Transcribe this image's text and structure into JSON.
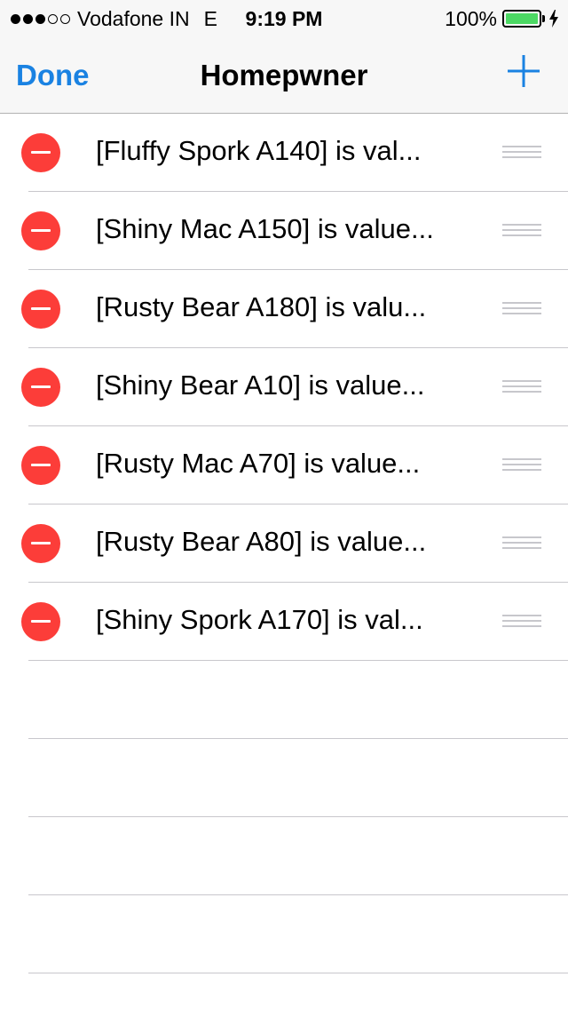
{
  "status_bar": {
    "signal": "●●●○○",
    "carrier": "Vodafone IN",
    "network": "E",
    "time": "9:19 PM",
    "battery_percent": "100%",
    "battery_color": "#4cd964"
  },
  "nav_bar": {
    "left_button": "Done",
    "title": "Homepwner",
    "right_icon": "plus-icon",
    "accent_color": "#1a82e2"
  },
  "items": [
    {
      "label": "[Fluffy Spork A140] is val..."
    },
    {
      "label": "[Shiny Mac A150] is value..."
    },
    {
      "label": "[Rusty Bear A180] is valu..."
    },
    {
      "label": "[Shiny Bear A10] is value..."
    },
    {
      "label": "[Rusty Mac A70] is value..."
    },
    {
      "label": "[Rusty Bear A80] is value..."
    },
    {
      "label": "[Shiny Spork A170] is val..."
    }
  ],
  "delete_color": "#fc3d39"
}
